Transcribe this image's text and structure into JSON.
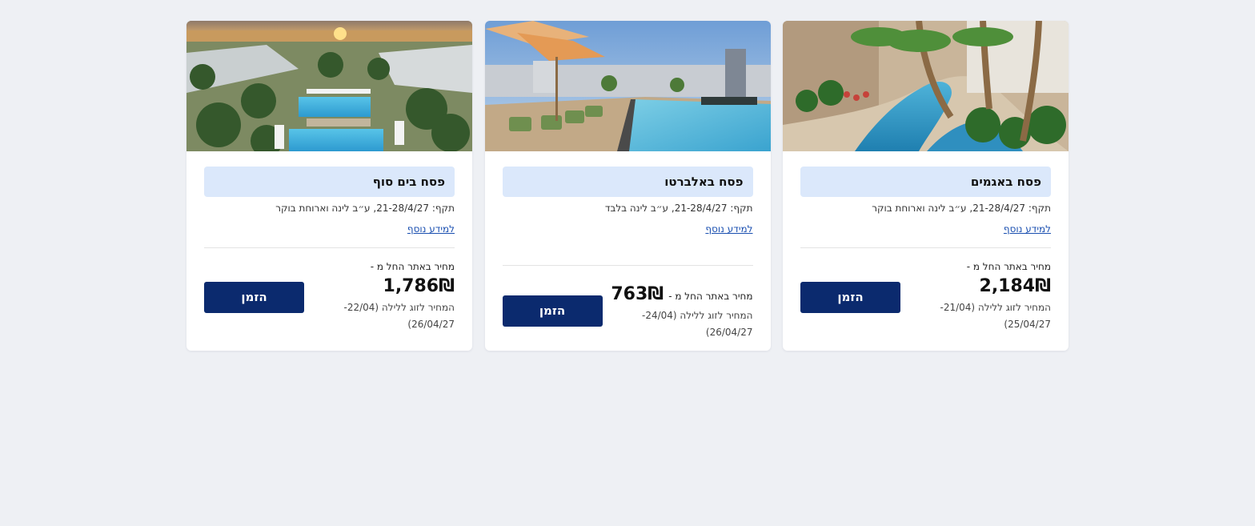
{
  "cards": [
    {
      "title": "פסח באגמים",
      "validity": "תקף: 21-28/4/27, ע״ב לינה וארוחת בוקר",
      "more_link": "למידע נוסף",
      "from_label": "מחיר באתר החל מ -",
      "price": "2,184₪",
      "note_line1": "המחיר לזוג ללילה (21/04-",
      "note_line2": "25/04/27)",
      "book_label": "הזמן",
      "image": "lagoon-pool-photo"
    },
    {
      "title": "פסח באלברטו",
      "validity": "תקף: 21-28/4/27, ע״ב לינה בלבד",
      "more_link": "למידע נוסף",
      "from_label": "מחיר באתר החל מ -",
      "price": "763₪",
      "note_line1": "המחיר לזוג ללילה (24/04-",
      "note_line2": "26/04/27)",
      "book_label": "הזמן",
      "image": "rooftop-pool-photo"
    },
    {
      "title": "פסח בים סוף",
      "validity": "תקף: 21-28/4/27, ע״ב לינה וארוחת בוקר",
      "more_link": "למידע נוסף",
      "from_label": "מחיר באתר החל מ -",
      "price": "1,786₪",
      "note_line1": "המחיר לזוג ללילה (22/04-",
      "note_line2": "26/04/27)",
      "book_label": "הזמן",
      "image": "resort-pool-sunset-photo"
    }
  ],
  "colors": {
    "background": "#eef0f4",
    "title_box": "#dbe8fb",
    "button": "#0b2a6e",
    "link": "#1a4fb0"
  }
}
